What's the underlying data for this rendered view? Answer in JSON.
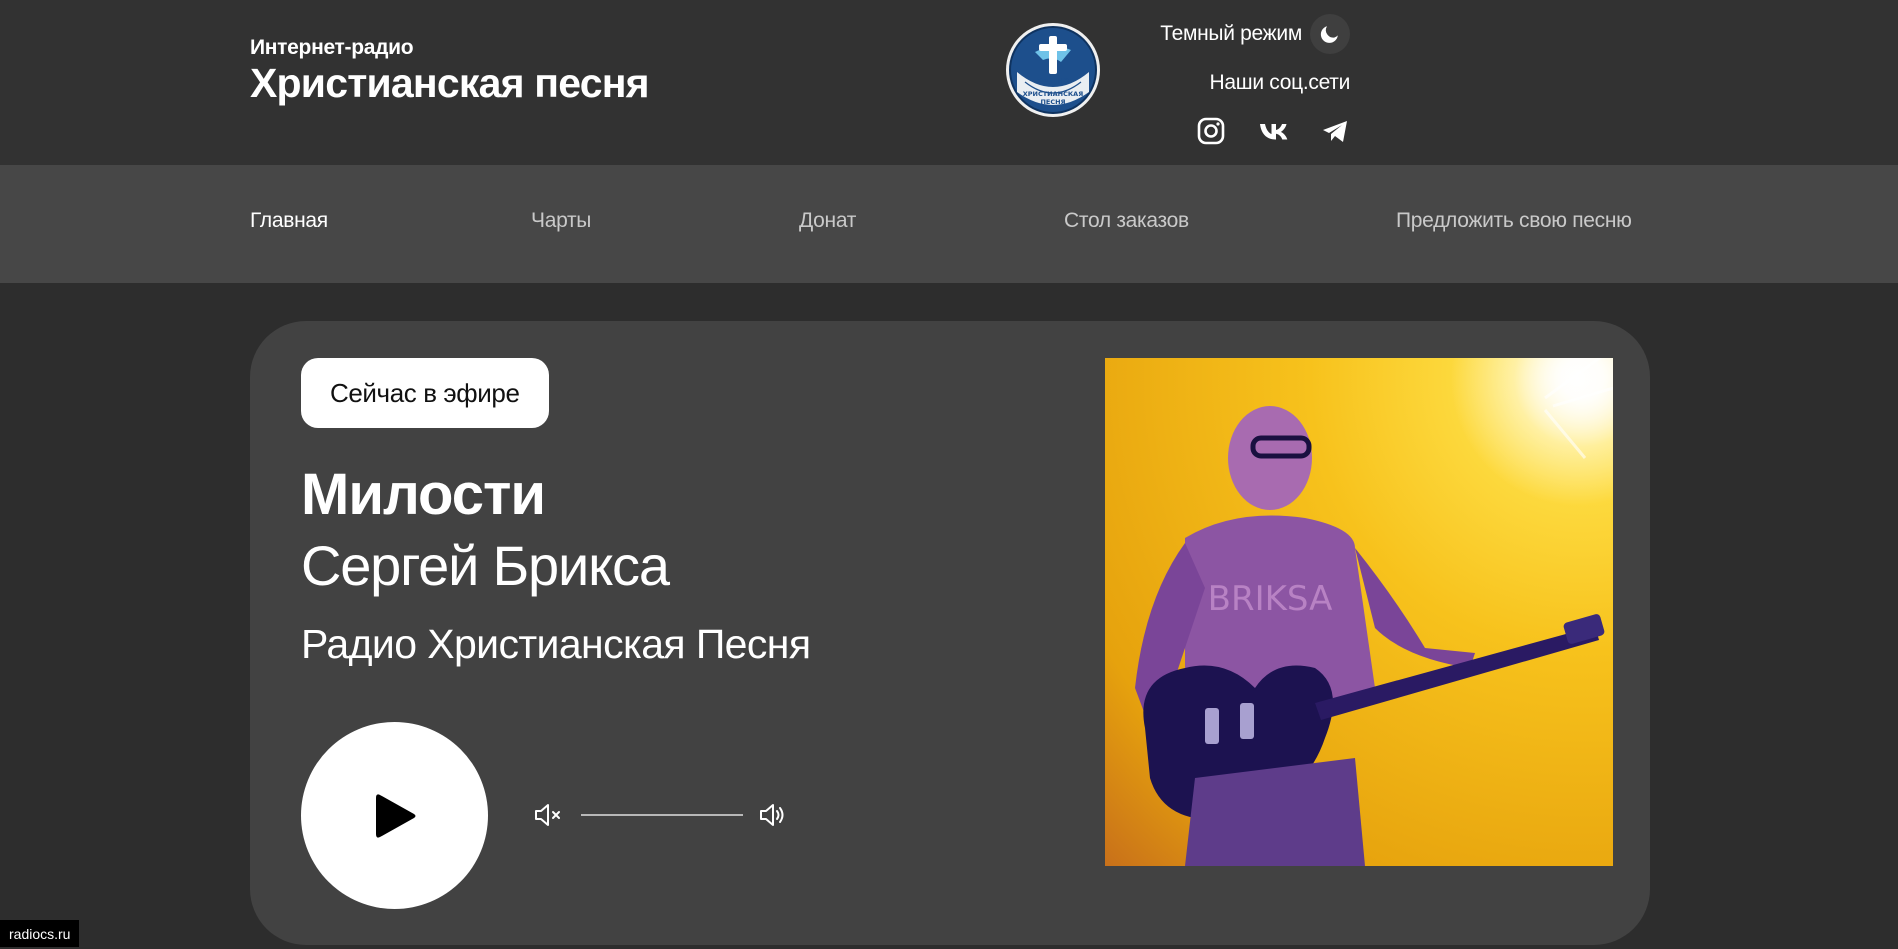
{
  "header": {
    "brand_subtitle": "Интернет-радио",
    "brand_title": "Христианская песня",
    "logo_text": "РАДИО ХРИСТИАНСКАЯ ПЕСНЯ",
    "theme_toggle_label": "Темный режим",
    "social_label": "Наши соц.сети",
    "social": [
      {
        "name": "instagram-icon"
      },
      {
        "name": "vk-icon"
      },
      {
        "name": "telegram-icon"
      }
    ]
  },
  "nav": {
    "items": [
      {
        "label": "Главная",
        "active": true
      },
      {
        "label": "Чарты",
        "active": false
      },
      {
        "label": "Донат",
        "active": false
      },
      {
        "label": "Стол заказов",
        "active": false
      },
      {
        "label": "Предложить свою песню",
        "active": false
      }
    ]
  },
  "player": {
    "on_air_label": "Сейчас в эфире",
    "song_title": "Милости",
    "artist": "Сергей Брикса",
    "station": "Радио Христианская Песня",
    "cover_text": "BRIKSA"
  },
  "status_bar": {
    "url": "radiocs.ru"
  },
  "colors": {
    "header_bg": "#323232",
    "nav_bg": "#474747",
    "card_bg": "#424242",
    "page_bg": "#2d2d2d"
  }
}
